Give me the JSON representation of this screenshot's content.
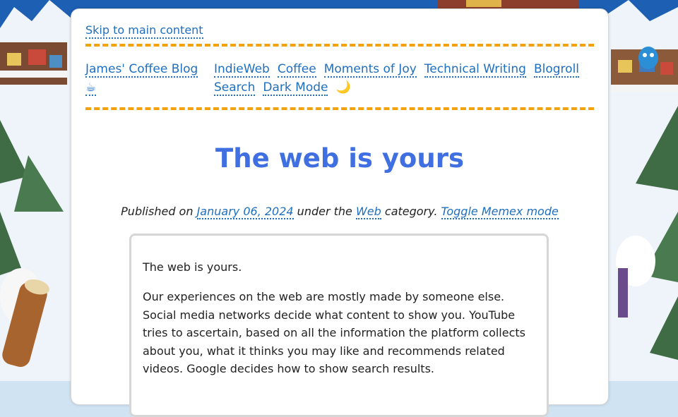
{
  "page": {
    "skip_link": "Skip to main content",
    "site_title": "James' Coffee Blog ☕",
    "nav": [
      {
        "label": "IndieWeb"
      },
      {
        "label": "Coffee"
      },
      {
        "label": "Moments of Joy"
      },
      {
        "label": "Technical Writing"
      },
      {
        "label": "Blogroll"
      },
      {
        "label": "Search"
      },
      {
        "label": "Dark Mode"
      }
    ],
    "dark_mode_glyph": "🌙",
    "colors": {
      "accent_dash": "#f2a20c",
      "title": "#3f6fe0",
      "link": "#1f6fbf"
    }
  },
  "post": {
    "title": "The web is yours",
    "meta": {
      "prefix": "Published on",
      "date": "January 06, 2024",
      "middle": "under the",
      "category": "Web",
      "suffix": "category.",
      "memex_toggle": "Toggle Memex mode"
    },
    "paragraphs": [
      "The web is yours.",
      "Our experiences on the web are mostly made by someone else. Social media networks decide what content to show you. YouTube tries to ascertain, based on all the information the platform collects about you, what it thinks you may like and recommends related videos. Google decides how to show search results."
    ]
  }
}
